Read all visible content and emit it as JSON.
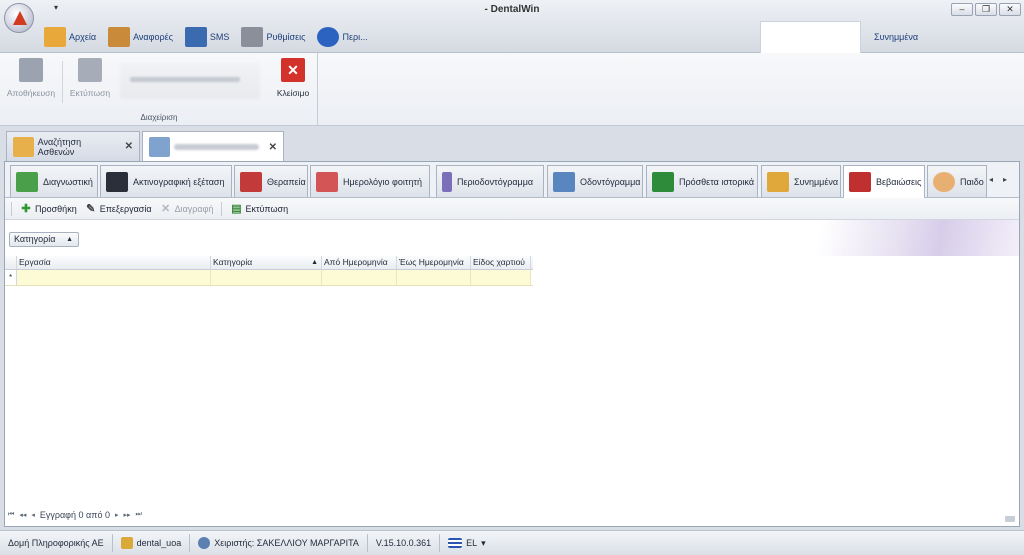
{
  "app": {
    "title": "- DentalWin",
    "qat_arrow": "▾"
  },
  "window": {
    "minimize": "–",
    "restore": "❐",
    "close": "✕"
  },
  "menu": {
    "items": [
      {
        "label": "Αρχεία",
        "icon": "folder-icon",
        "color": "#e8a93a"
      },
      {
        "label": "Αναφορές",
        "icon": "clipboard-icon",
        "color": "#c98a3a"
      },
      {
        "label": "SMS",
        "icon": "phone-icon",
        "color": "#3a6bb0"
      },
      {
        "label": "Ρυθμίσεις",
        "icon": "tools-icon",
        "color": "#8a8f99"
      },
      {
        "label": "Περι...",
        "icon": "info-icon",
        "color": "#2d63c0"
      }
    ],
    "sync_label": "Συνημμένα"
  },
  "ribbon": {
    "save_label": "Αποθήκευση",
    "print_label": "Εκτύπωση",
    "close_label": "Κλείσιμο",
    "group_label": "Διαχείριση"
  },
  "doc_tabs": {
    "search_label": "Αναζήτηση Ασθενών",
    "close_glyph": "✕"
  },
  "sub_tabs": [
    {
      "label": "Διαγνωστική",
      "icon": "checklist-icon",
      "color": "#4aa04a"
    },
    {
      "label": "Ακτινογραφική εξέταση",
      "icon": "monitor-icon",
      "color": "#2a2f3a"
    },
    {
      "label": "Θεραπεία",
      "icon": "first-aid-icon",
      "color": "#c23a3a"
    },
    {
      "label": "Ημερολόγιο φοιτητή",
      "icon": "calendar-icon",
      "color": "#d45555"
    },
    {
      "label": "Περιοδοντόγραμμα",
      "icon": "chart-bars-icon",
      "color": "#7a6fb8"
    },
    {
      "label": "Οδοντόγραμμα",
      "icon": "magnifier-icon",
      "color": "#5a86c0"
    },
    {
      "label": "Πρόσθετα ιστορικά",
      "icon": "xls-disk-icon",
      "color": "#2e8b3a"
    },
    {
      "label": "Συνημμένα",
      "icon": "folder-icon",
      "color": "#e0a83a"
    },
    {
      "label": "Βεβαιώσεις",
      "icon": "pdf-printer-icon",
      "color": "#c03030"
    },
    {
      "label": "Παιδο",
      "icon": "child-icon",
      "color": "#e8b070"
    }
  ],
  "toolbar": {
    "add_label": "Προσθήκη",
    "edit_label": "Επεξεργασία",
    "delete_label": "Διαγραφή",
    "print_label": "Εκτύπωση"
  },
  "grouping": {
    "chip_label": "Κατηγορία",
    "chip_arrow": "▲"
  },
  "grid": {
    "columns": [
      "Εργασία",
      "Κατηγορία",
      "Από Ημερομηνία",
      "Έως Ημερομηνία",
      "Είδος χαρτιού"
    ],
    "sort_arrow": "▲",
    "new_row_marker": "*"
  },
  "navigator": {
    "record_text": "Εγγραφή 0 από 0"
  },
  "status": {
    "company": "Δομή Πληροφορικής ΑΕ",
    "database": "dental_uoa",
    "user": "Χειριστής: ΣΑΚΕΛΛΙΟΥ ΜΑΡΓΑΡΙΤΑ",
    "version": "V.15.10.0.361",
    "language": "EL"
  }
}
